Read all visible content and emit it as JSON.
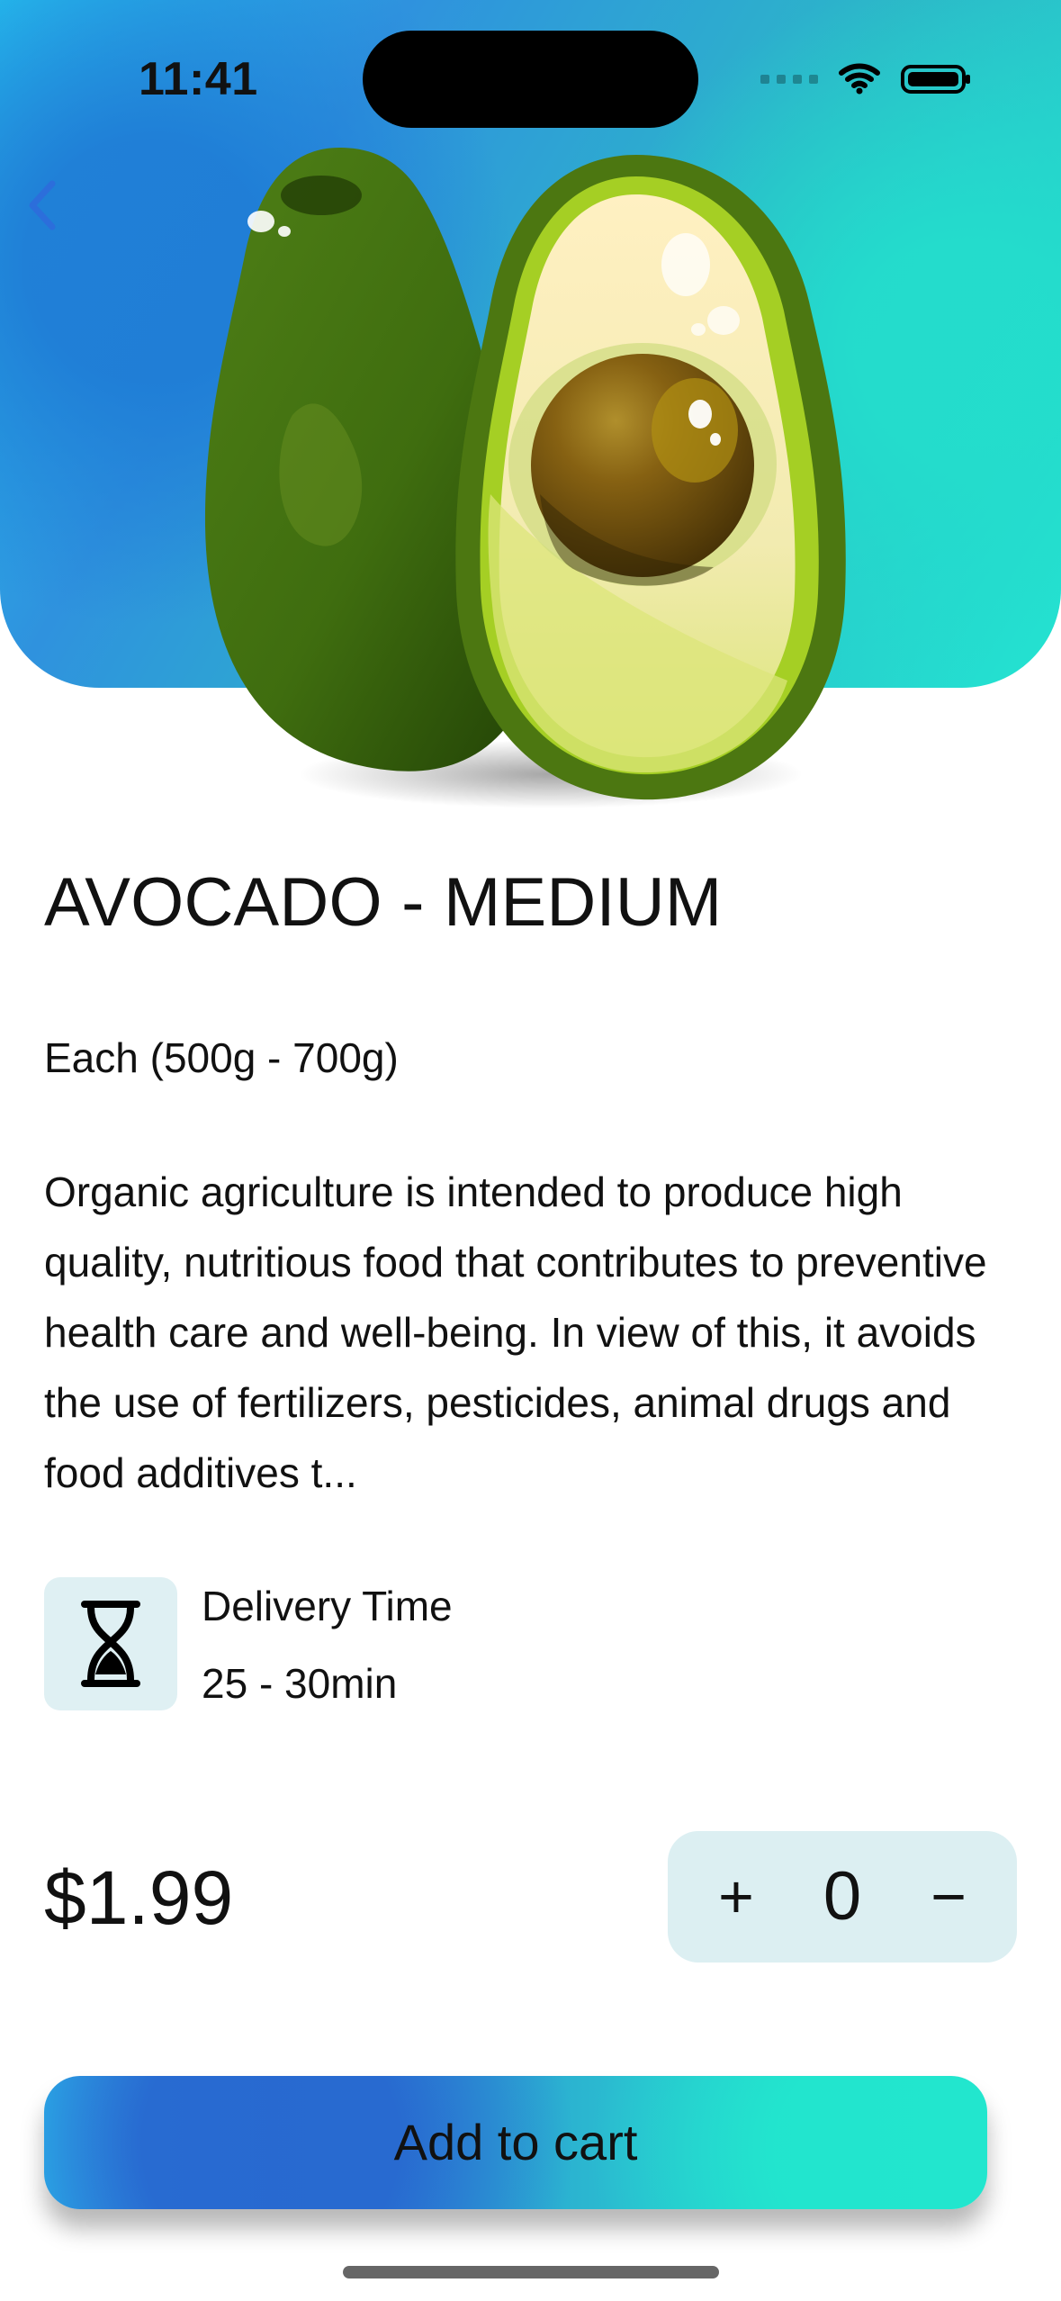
{
  "status_bar": {
    "time": "11:41"
  },
  "navigation": {
    "back_icon": "chevron-left-icon"
  },
  "product": {
    "title": "AVOCADO - MEDIUM",
    "size": "Each (500g - 700g)",
    "description": "Organic agriculture is intended to produce high quality, nutritious food that contributes to preventive health care and well-being. In view of this, it avoids the use of fertilizers, pesticides, animal drugs and food additives t...",
    "image_icon": "avocado-illustration"
  },
  "delivery": {
    "icon": "hourglass-icon",
    "label": "Delivery Time",
    "value": "25 - 30min"
  },
  "purchase": {
    "price": "$1.99",
    "increment_label": "+",
    "quantity": "0",
    "decrement_label": "−",
    "add_to_cart_label": "Add to cart"
  },
  "colors": {
    "accent_blue": "#2E7FDA",
    "accent_teal": "#24E4D1",
    "stepper_bg": "#DCEFF2",
    "delivery_icon_bg": "#DFF0F3",
    "back_button": "#2C6EDB"
  }
}
